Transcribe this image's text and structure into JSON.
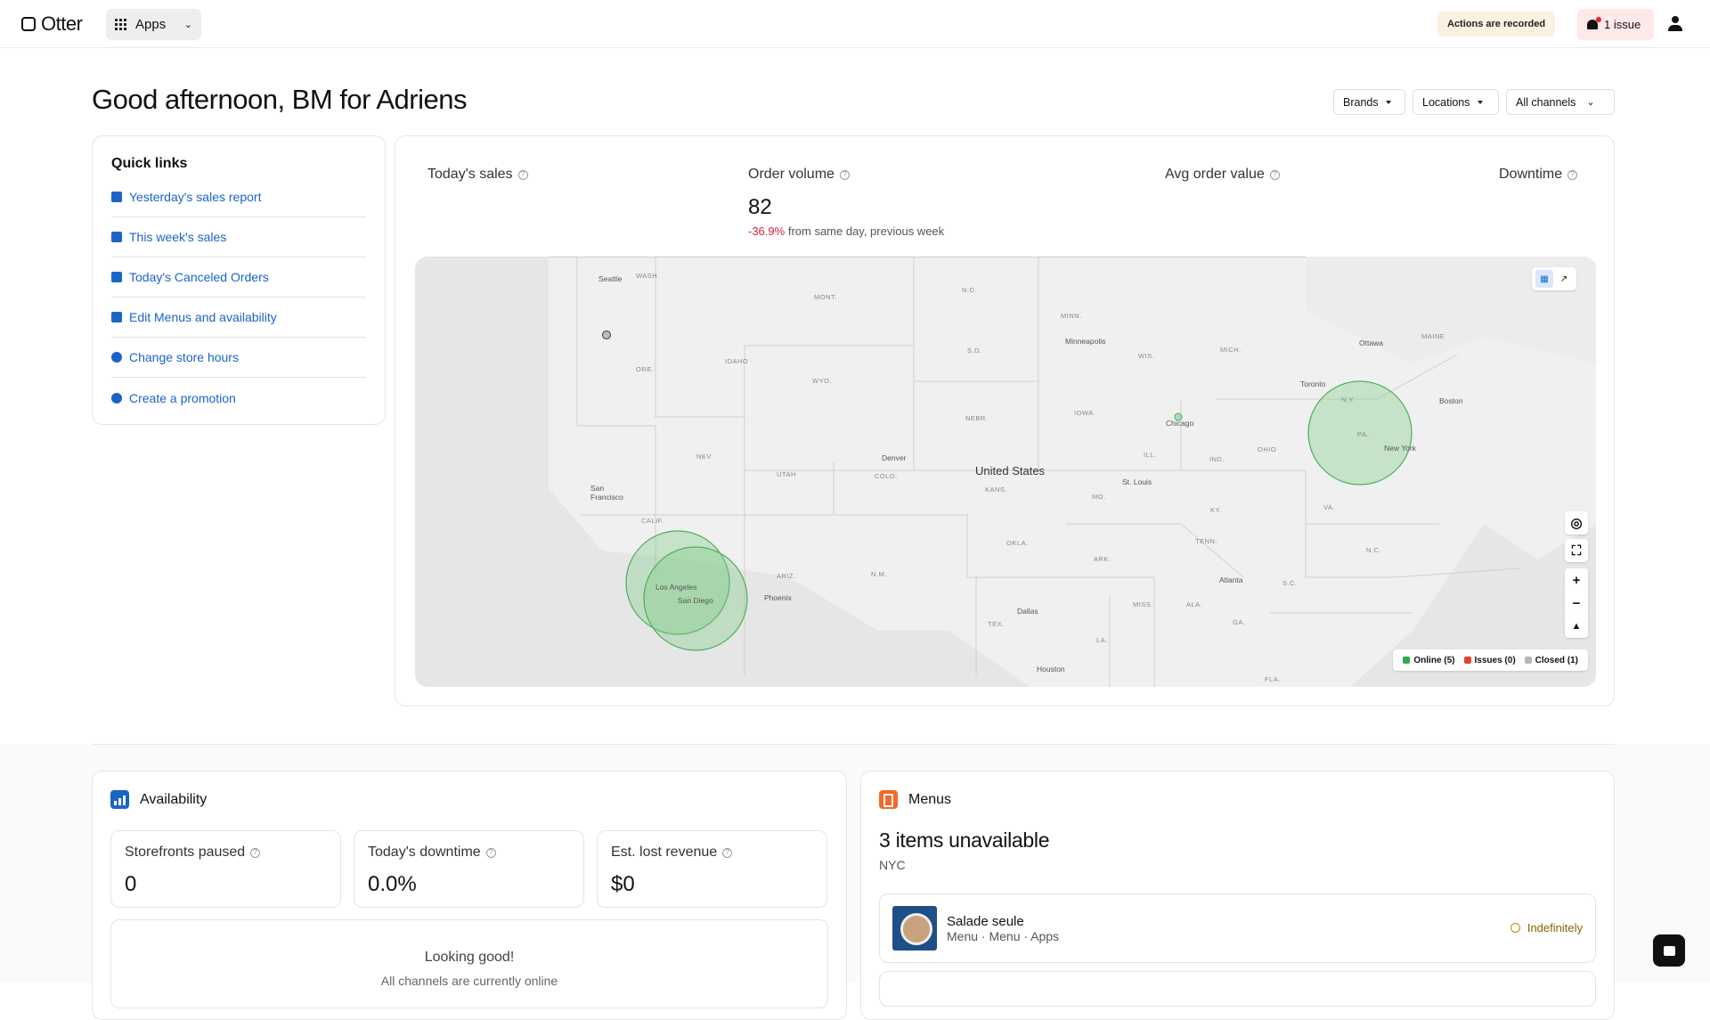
{
  "topbar": {
    "logo": "Otter",
    "apps_label": "Apps",
    "recorded_label": "Actions are recorded",
    "issue_label": "1 issue"
  },
  "greeting": "Good afternoon, BM for Adriens",
  "filters": {
    "brands": "Brands",
    "locations": "Locations",
    "channels": "All channels"
  },
  "quick_links": {
    "title": "Quick links",
    "items": [
      {
        "label": "Yesterday's sales report",
        "icon": "report-icon"
      },
      {
        "label": "This week's sales",
        "icon": "document-icon"
      },
      {
        "label": "Today's Canceled Orders",
        "icon": "canceled-orders-icon"
      },
      {
        "label": "Edit Menus and availability",
        "icon": "utensils-icon"
      },
      {
        "label": "Change store hours",
        "icon": "clock-icon"
      },
      {
        "label": "Create a promotion",
        "icon": "dollar-icon"
      }
    ]
  },
  "metrics": {
    "todays_sales": "Today's sales",
    "order_volume": "Order volume",
    "order_volume_value": "82",
    "order_volume_delta": "-36.9%",
    "order_volume_delta_text": "from same day, previous week",
    "avg_order_value": "Avg order value",
    "downtime": "Downtime"
  },
  "map": {
    "country": "United States",
    "cities": [
      "Seattle",
      "Minneapolis",
      "Ottawa",
      "Toronto",
      "Boston",
      "Chicago",
      "New York",
      "Denver",
      "San Francisco",
      "St. Louis",
      "Los Angeles",
      "San Diego",
      "Phoenix",
      "Atlanta",
      "Dallas",
      "Houston"
    ],
    "states": [
      "WASH.",
      "MONT.",
      "N.D.",
      "MINN.",
      "MAINE",
      "ORE.",
      "IDAHO",
      "S.D.",
      "WIS.",
      "MICH.",
      "WYO.",
      "NEBR.",
      "IOWA",
      "N.Y.",
      "PA.",
      "NEV.",
      "UTAH",
      "COLO.",
      "KANS.",
      "ILL.",
      "IND.",
      "OHIO",
      "CALIF.",
      "MO.",
      "KY.",
      "VA.",
      "OKLA.",
      "ARK.",
      "TENN.",
      "N.C.",
      "ARIZ.",
      "N.M.",
      "MISS.",
      "ALA.",
      "S.C.",
      "TEX.",
      "LA.",
      "GA.",
      "FLA."
    ],
    "legend": {
      "online": "Online (5)",
      "issues": "Issues (0)",
      "closed": "Closed (1)"
    },
    "colors": {
      "online": "#2fa84f",
      "issues": "#e0442e",
      "closed": "#b5b5b5"
    }
  },
  "availability": {
    "title": "Availability",
    "stats": [
      {
        "label": "Storefronts paused",
        "value": "0"
      },
      {
        "label": "Today's downtime",
        "value": "0.0%"
      },
      {
        "label": "Est. lost revenue",
        "value": "$0"
      }
    ],
    "good_title": "Looking good!",
    "good_sub": "All channels are currently online"
  },
  "menus": {
    "title": "Menus",
    "headline": "3 items unavailable",
    "location": "NYC",
    "item_name": "Salade seule",
    "item_path": "Menu · Menu · Apps",
    "item_status": "Indefinitely"
  }
}
